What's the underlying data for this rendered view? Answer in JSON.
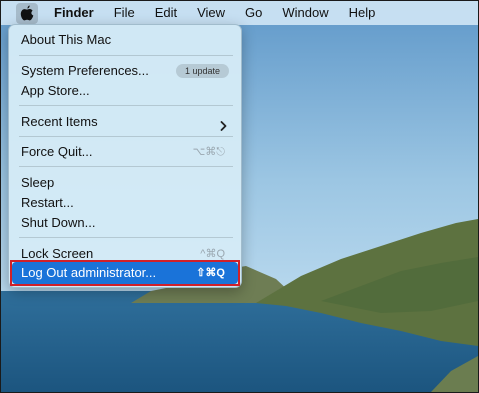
{
  "menubar": {
    "apple_icon": "apple-icon",
    "items": [
      "Finder",
      "File",
      "Edit",
      "View",
      "Go",
      "Window",
      "Help"
    ]
  },
  "apple_menu": {
    "about": "About This Mac",
    "system_preferences": "System Preferences...",
    "update_badge": "1 update",
    "app_store": "App Store...",
    "recent_items": "Recent Items",
    "force_quit": "Force Quit...",
    "force_quit_shortcut": "⌥⌘⎋",
    "sleep": "Sleep",
    "restart": "Restart...",
    "shut_down": "Shut Down...",
    "lock_screen": "Lock Screen",
    "lock_screen_shortcut": "^⌘Q",
    "log_out": "Log Out administrator...",
    "log_out_shortcut": "⇧⌘Q"
  },
  "colors": {
    "selection": "#1a73d9",
    "annotation_border": "#d0202a",
    "menu_background": "#d4eaf6"
  }
}
